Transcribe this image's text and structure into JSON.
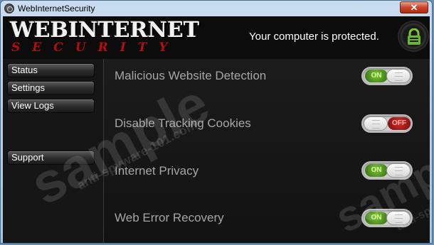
{
  "window": {
    "title": "WebInternetSecurity",
    "close_symbol": "✕"
  },
  "logo": {
    "main": "WEBINTERNET",
    "sub": "SECURITY"
  },
  "status_text": "Your computer is protected.",
  "sidebar": {
    "items": [
      {
        "label": "Status"
      },
      {
        "label": "Settings"
      },
      {
        "label": "View Logs"
      },
      {
        "label": "Support"
      }
    ]
  },
  "features": [
    {
      "label": "Malicious Website Detection",
      "state": "ON"
    },
    {
      "label": "Disable Tracking Cookies",
      "state": "OFF"
    },
    {
      "label": "Internet Privacy",
      "state": "ON"
    },
    {
      "label": "Web Error Recovery",
      "state": "ON"
    }
  ],
  "watermark": {
    "big": "sample",
    "small": "anti-spyware-101.com"
  },
  "colors": {
    "on": "#4a9a1e",
    "off": "#b51010",
    "logo_red": "#b50c0c",
    "label_gray": "#a6a6a6"
  },
  "icons": {
    "app": "app-icon",
    "shield": "lock-shield-icon",
    "close": "close-icon"
  }
}
